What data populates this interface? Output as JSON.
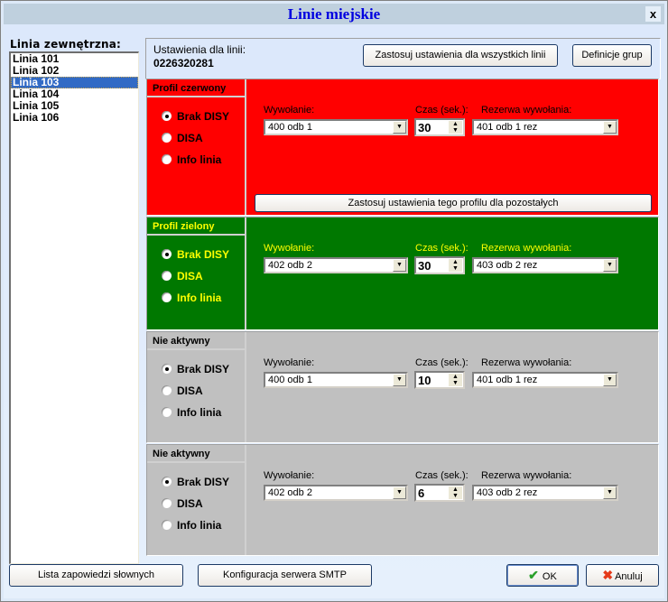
{
  "window": {
    "title": "Linie miejskie",
    "close_label": "x"
  },
  "lines": {
    "label": "Linia zewnętrzna:",
    "items": [
      "Linia 101",
      "Linia 102",
      "Linia 103",
      "Linia 104",
      "Linia 105",
      "Linia 106"
    ],
    "selected": "Linia 103"
  },
  "settings": {
    "label": "Ustawienia dla linii:",
    "line_number": "0226320281",
    "apply_all_label": "Zastosuj ustawienia dla wszystkich linii",
    "groups_label": "Definicje grup"
  },
  "field_labels": {
    "call": "Wywołanie:",
    "time": "Czas (sek.):",
    "backup": "Rezerwa wywołania:"
  },
  "radio_labels": [
    "Brak DISY",
    "DISA",
    "Info linia"
  ],
  "profiles": [
    {
      "title": "Profil czerwony",
      "bg": "#ff0000",
      "fg": "#000000",
      "selected_radio": "Brak DISY",
      "call": "400  odb 1",
      "time": "30",
      "backup": "401  odb 1 rez",
      "apply_label": "Zastosuj ustawienia tego profilu dla pozostałych"
    },
    {
      "title": "Profil zielony",
      "bg": "#007800",
      "fg": "#ffff00",
      "selected_radio": "Brak DISY",
      "call": "402  odb 2",
      "time": "30",
      "backup": "403  odb 2 rez"
    },
    {
      "title": "Nie aktywny",
      "bg": "#c0c0c0",
      "fg": "#000000",
      "selected_radio": "Brak DISY",
      "call": "400  odb 1",
      "time": "10",
      "backup": "401  odb 1 rez"
    },
    {
      "title": "Nie aktywny",
      "bg": "#c0c0c0",
      "fg": "#000000",
      "selected_radio": "Brak DISY",
      "call": "402  odb 2",
      "time": "6",
      "backup": "403  odb 2 rez"
    }
  ],
  "footer": {
    "announcements_label": "Lista zapowiedzi słownych",
    "smtp_label": "Konfiguracja serwera SMTP",
    "ok_label": "OK",
    "cancel_label": "Anuluj",
    "ok_icon": "checkmark-icon",
    "cancel_icon": "x-cross-icon"
  }
}
